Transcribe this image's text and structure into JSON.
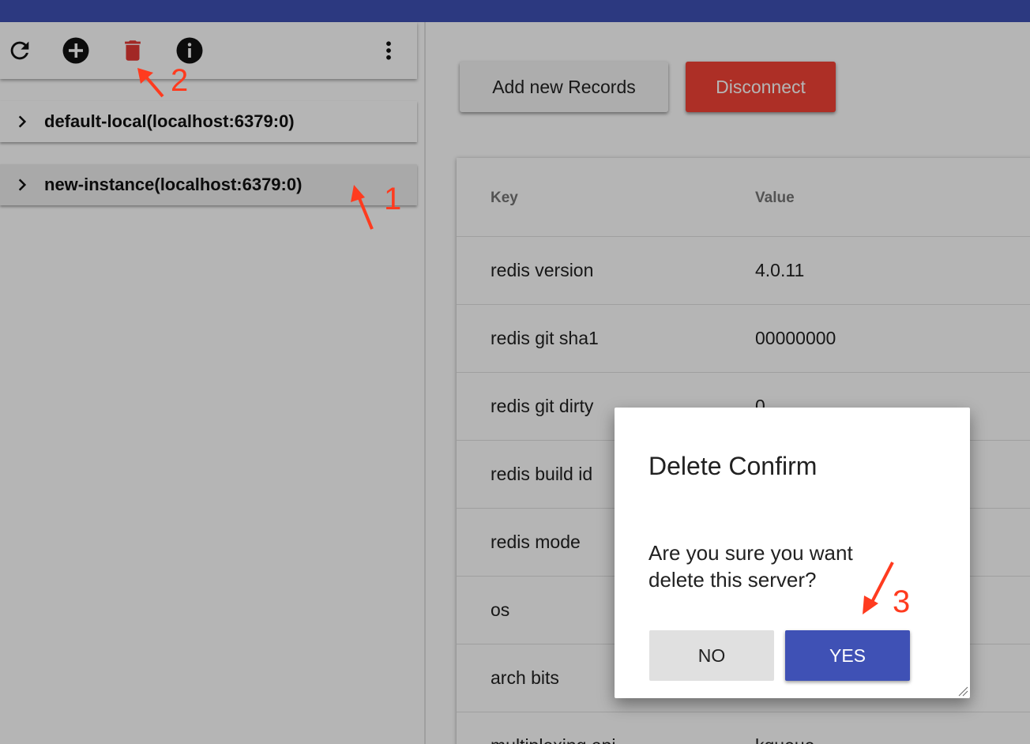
{
  "colors": {
    "topbar": "#3f51b5",
    "disconnect": "#f44336",
    "yes": "#3f51b5",
    "delete_icon": "#e53935",
    "annotation": "#ff3b1f"
  },
  "toolbar": {
    "icons": [
      "refresh-icon",
      "add-circle-icon",
      "delete-icon",
      "info-icon",
      "more-vert-icon"
    ]
  },
  "servers": [
    {
      "label": "default-local(localhost:6379:0)",
      "selected": false
    },
    {
      "label": "new-instance(localhost:6379:0)",
      "selected": true
    }
  ],
  "actions": {
    "add_records": "Add new Records",
    "disconnect": "Disconnect"
  },
  "table": {
    "headers": {
      "key": "Key",
      "value": "Value"
    },
    "rows": [
      {
        "key": "redis version",
        "value": "4.0.11"
      },
      {
        "key": "redis git sha1",
        "value": "00000000"
      },
      {
        "key": "redis git dirty",
        "value": "0"
      },
      {
        "key": "redis build id",
        "value": ""
      },
      {
        "key": "redis mode",
        "value": ""
      },
      {
        "key": "os",
        "value": ""
      },
      {
        "key": "arch bits",
        "value": ""
      },
      {
        "key": "multiplexing api",
        "value": "kqueue"
      }
    ]
  },
  "dialog": {
    "title": "Delete Confirm",
    "message": "Are you sure you want delete this server?",
    "no": "NO",
    "yes": "YES"
  },
  "annotations": [
    "1",
    "2",
    "3"
  ]
}
